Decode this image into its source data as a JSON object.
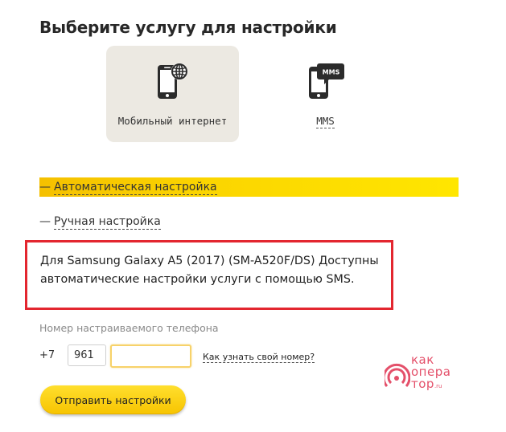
{
  "page": {
    "title": "Выберите услугу для настройки"
  },
  "services": [
    {
      "label": "Мобильный интернет",
      "icon": "phone-globe-icon",
      "active": true
    },
    {
      "label": "MMS",
      "icon": "phone-mms-icon",
      "active": false,
      "badge": "MMS"
    }
  ],
  "options": {
    "dash": "—",
    "auto_label": "Автоматическая настройка",
    "manual_label": "Ручная настройка"
  },
  "note": {
    "line1": "Для Samsung Galaxy A5 (2017) (SM-A520F/DS) Доступны",
    "line2": "автоматические настройки услуги с помощью SMS."
  },
  "form": {
    "phone_label": "Номер настраиваемого телефона",
    "prefix": "+7",
    "code_value": "961",
    "number_value": "",
    "howto_link": "Как узнать свой номер?",
    "submit_label": "Отправить настройки"
  },
  "watermark": {
    "line1": "как",
    "line2": "опера",
    "line3": "тор",
    "tld": ".ru"
  },
  "colors": {
    "accent_yellow": "#fbd500",
    "highlight_red": "#e3262f",
    "logo_pink": "#e4506a",
    "active_tile": "#ece9e2"
  }
}
